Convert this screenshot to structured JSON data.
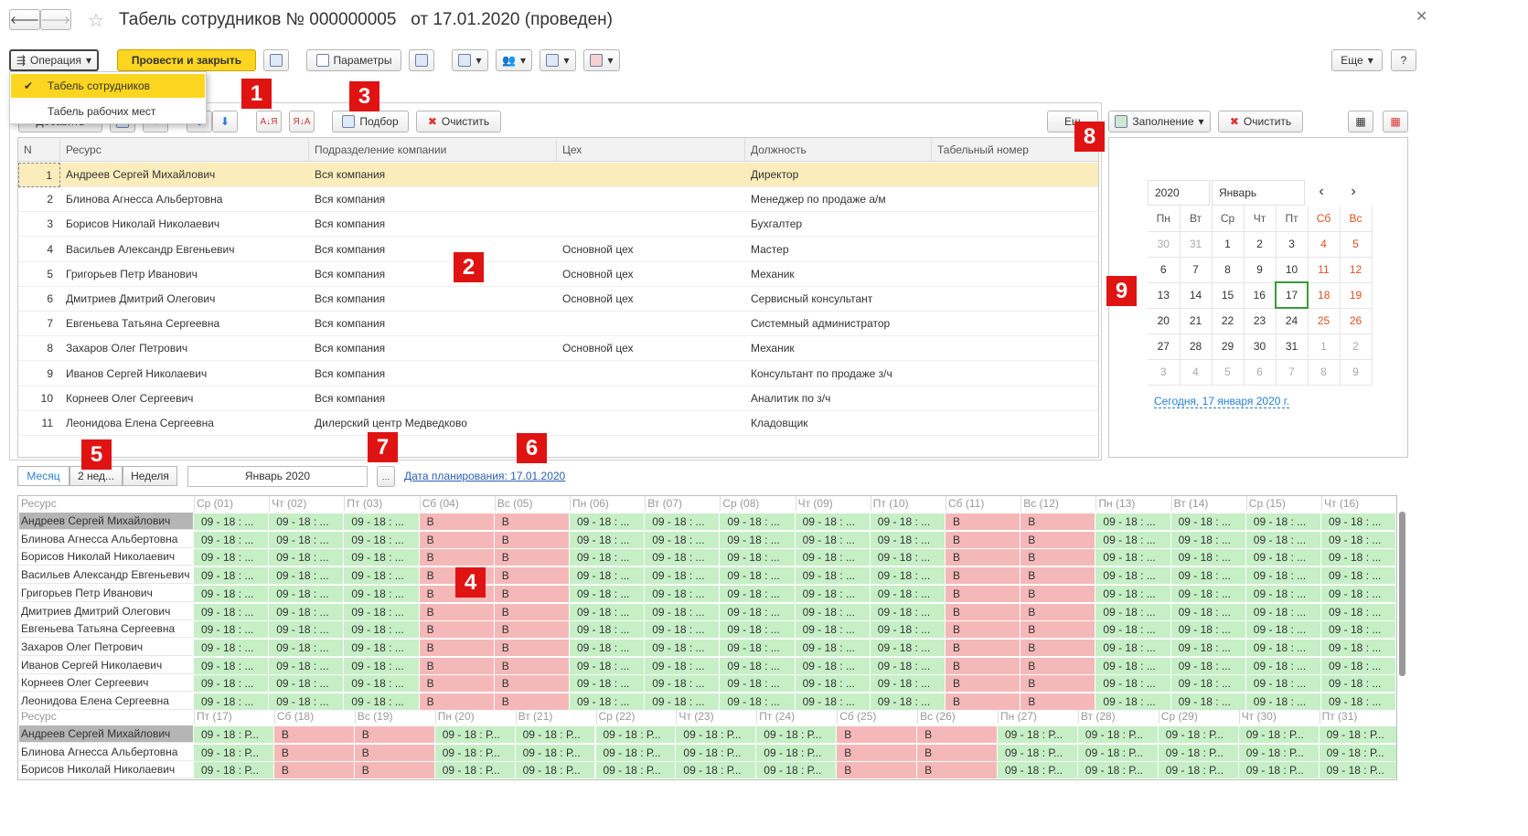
{
  "title": "Табель сотрудников № 000000005   от 17.01.2020 (проведен)",
  "toolbar": {
    "operation": "Операция",
    "post_close": "Провести и закрыть",
    "params": "Параметры",
    "more": "Еще",
    "help": "?"
  },
  "menu": {
    "item1": "Табель сотрудников",
    "item2": "Табель рабочих мест"
  },
  "tabletoolbar": {
    "add": "Добавить",
    "selection": "Подбор",
    "clear": "Очистить",
    "more": "Ещ"
  },
  "badges": [
    "1",
    "2",
    "3",
    "4",
    "5",
    "6",
    "7",
    "8",
    "9"
  ],
  "table": {
    "columns": [
      "N",
      "Ресурс",
      "Подразделение компании",
      "Цех",
      "Должность",
      "Табельный номер"
    ],
    "rows": [
      [
        "1",
        "Андреев Сергей Михайлович",
        "Вся компания",
        "",
        "Директор",
        ""
      ],
      [
        "2",
        "Блинова Агнесса Альбертовна",
        "Вся компания",
        "",
        "Менеджер по продаже а/м",
        ""
      ],
      [
        "3",
        "Борисов Николай Николаевич",
        "Вся компания",
        "",
        "Бухгалтер",
        ""
      ],
      [
        "4",
        "Васильев Александр Евгеньевич",
        "Вся компания",
        "Основной цех",
        "Мастер",
        ""
      ],
      [
        "5",
        "Григорьев Петр Иванович",
        "Вся компания",
        "Основной цех",
        "Механик",
        ""
      ],
      [
        "6",
        "Дмитриев Дмитрий Олегович",
        "Вся компания",
        "Основной цех",
        "Сервисный консультант",
        ""
      ],
      [
        "7",
        "Евгеньева Татьяна Сергеевна",
        "Вся компания",
        "",
        "Системный администратор",
        ""
      ],
      [
        "8",
        "Захаров Олег Петрович",
        "Вся компания",
        "Основной цех",
        "Механик",
        ""
      ],
      [
        "9",
        "Иванов Сергей Николаевич",
        "Вся компания",
        "",
        "Консультант по продаже з/ч",
        ""
      ],
      [
        "10",
        "Корнеев Олег Сергеевич",
        "Вся компания",
        "",
        "Аналитик по з/ч",
        ""
      ],
      [
        "11",
        "Леонидова Елена Сергеевна",
        "Дилерский центр Медведково",
        "",
        "Кладовщик",
        ""
      ]
    ]
  },
  "right": {
    "fill": "Заполнение",
    "clear": "Очистить"
  },
  "calendar": {
    "year": "2020",
    "month": "Январь",
    "prev": "‹",
    "next": "›",
    "weekdays": [
      "Пн",
      "Вт",
      "Ср",
      "Чт",
      "Пт",
      "Сб",
      "Вс"
    ],
    "weeks": [
      [
        "30",
        "31",
        "1",
        "2",
        "3",
        "4",
        "5"
      ],
      [
        "6",
        "7",
        "8",
        "9",
        "10",
        "11",
        "12"
      ],
      [
        "13",
        "14",
        "15",
        "16",
        "17",
        "18",
        "19"
      ],
      [
        "20",
        "21",
        "22",
        "23",
        "24",
        "25",
        "26"
      ],
      [
        "27",
        "28",
        "29",
        "30",
        "31",
        "1",
        "2"
      ],
      [
        "3",
        "4",
        "5",
        "6",
        "7",
        "8",
        "9"
      ]
    ],
    "today": "Сегодня, 17 января 2020 г."
  },
  "period": {
    "month": "Месяц",
    "two_weeks": "2 нед...",
    "week": "Неделя",
    "current": "Январь 2020",
    "planning": "Дата планирования: 17.01.2020"
  },
  "schedule": {
    "resource_label": "Ресурс",
    "names": [
      "Андреев Сергей Михайлович",
      "Блинова Агнесса Альбертовна",
      "Борисов Николай Николаевич",
      "Васильев Александр Евгеньевич",
      "Григорьев Петр Иванович",
      "Дмитриев Дмитрий Олегович",
      "Евгеньева Татьяна Сергеевна",
      "Захаров Олег Петрович",
      "Иванов Сергей Николаевич",
      "Корнеев Олег Сергеевич",
      "Леонидова Елена Сергеевна"
    ],
    "days1": [
      "Ср (01)",
      "Чт (02)",
      "Пт (03)",
      "Сб (04)",
      "Вс (05)",
      "Пн (06)",
      "Вт (07)",
      "Ср (08)",
      "Чт (09)",
      "Пт (10)",
      "Сб (11)",
      "Вс (12)",
      "Пн (13)",
      "Вт (14)",
      "Ср (15)",
      "Чт (16)"
    ],
    "days2": [
      "Пт (17)",
      "Сб (18)",
      "Вс (19)",
      "Пн (20)",
      "Вт (21)",
      "Ср (22)",
      "Чт (23)",
      "Пт (24)",
      "Сб (25)",
      "Вс (26)",
      "Пн (27)",
      "Вт (28)",
      "Ср (29)",
      "Чт (30)",
      "Пт (31)"
    ],
    "work": "09 - 18 : ...",
    "work2": "09 - 18 : Р...",
    "off": "В",
    "names2": [
      "Андреев Сергей Михайлович",
      "Блинова Агнесса Альбертовна",
      "Борисов Николай Николаевич"
    ]
  },
  "colors": {
    "green": "#c6efc6",
    "red": "#f5b8b8",
    "accent": "#fcd520",
    "badge": "#e01313"
  }
}
